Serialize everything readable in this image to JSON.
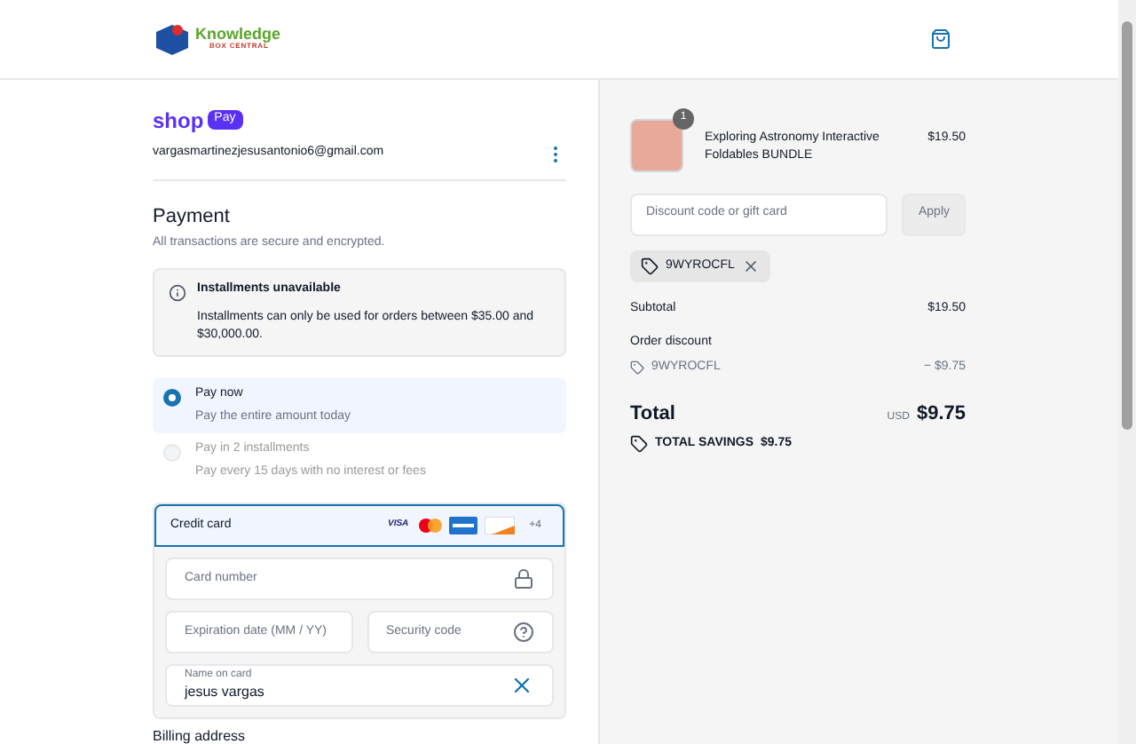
{
  "header": {
    "logo_word": "Knowledge",
    "logo_tagline": "BOX CENTRAL"
  },
  "shop_pay": {
    "word": "shop",
    "badge": "Pay",
    "email": "vargasmartinezjesusantonio6@gmail.com"
  },
  "payment": {
    "title": "Payment",
    "subtitle": "All transactions are secure and encrypted.",
    "notice": {
      "title": "Installments unavailable",
      "text": "Installments can only be used for orders between $35.00 and $30,000.00."
    },
    "options": [
      {
        "label": "Pay now",
        "detail": "Pay the entire amount today",
        "selected": true,
        "disabled": false
      },
      {
        "label": "Pay in 2 installments",
        "detail": "Pay every 15 days with no interest or fees",
        "selected": false,
        "disabled": true
      }
    ],
    "method": {
      "label": "Credit card",
      "selected": true,
      "visa": "VISA",
      "more": "+4"
    },
    "fields": [
      {
        "kind": "lock",
        "placeholder": "Card number"
      },
      {
        "kind": "plain",
        "placeholder": "Expiration date (MM / YY)"
      },
      {
        "kind": "help",
        "placeholder": "Security code"
      },
      {
        "kind": "clear",
        "label": "Name on card",
        "value": "jesus vargas"
      }
    ],
    "next_section": "Billing address"
  },
  "summary": {
    "item": {
      "quantity": "1",
      "title": "Exploring Astronomy Interactive Foldables BUNDLE",
      "price": "$19.50"
    },
    "discount_field": {
      "placeholder": "Discount code or gift card",
      "button": "Apply"
    },
    "applied_code": "9WYROCFL",
    "lines": [
      {
        "label": "Subtotal",
        "value": "$19.50"
      }
    ],
    "order_discount": {
      "label": "Order discount",
      "code": "9WYROCFL",
      "value": "− $9.75"
    },
    "total": {
      "label": "Total",
      "currency": "USD",
      "value": "$9.75"
    },
    "savings": {
      "label": "TOTAL SAVINGS",
      "value": "$9.75"
    }
  }
}
